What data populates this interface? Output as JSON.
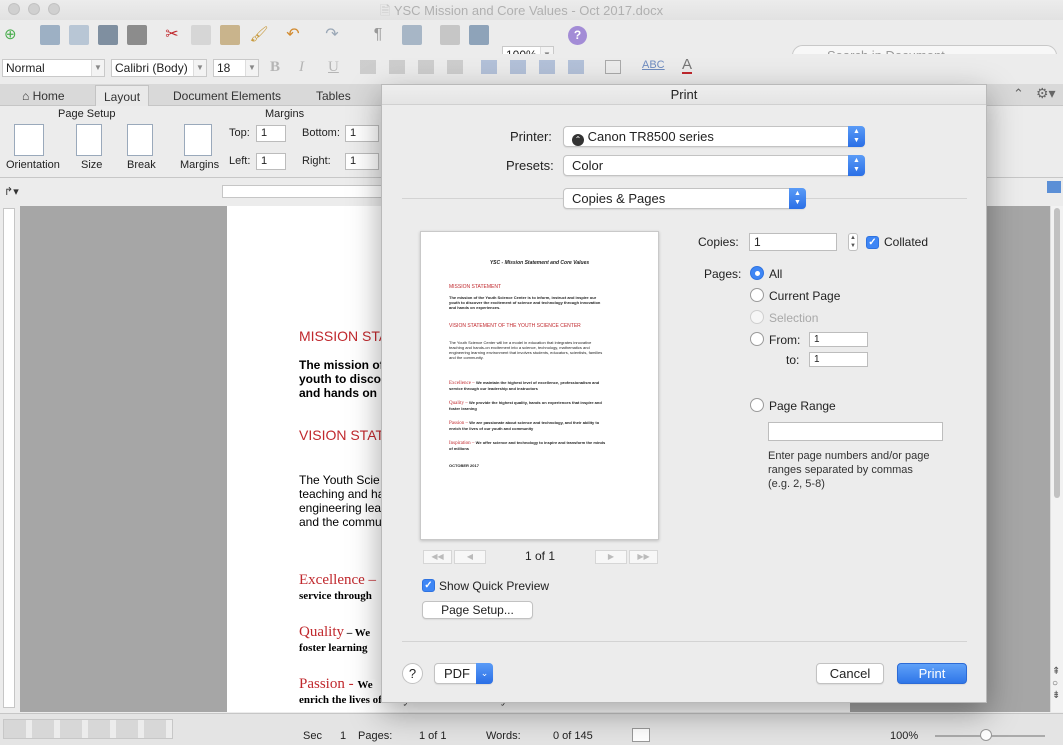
{
  "window": {
    "title": "YSC Mission and Core Values - Oct 2017.docx"
  },
  "toolbar": {
    "zoom": "100%",
    "search_placeholder": "Search in Document"
  },
  "format_bar": {
    "style": "Normal",
    "font": "Calibri (Body)",
    "size": "18"
  },
  "ribbon": {
    "tabs": [
      "Home",
      "Layout",
      "Document Elements",
      "Tables"
    ],
    "active_tab": "Layout",
    "page_setup_label": "Page Setup",
    "margins_label": "Margins",
    "buttons": {
      "orientation": "Orientation",
      "size": "Size",
      "break": "Break",
      "margins": "Margins"
    },
    "top_label": "Top:",
    "top_value": "1",
    "bottom_label": "Bottom:",
    "bottom_value": "1",
    "left_label": "Left:",
    "left_value": "1",
    "right_label": "Right:",
    "right_value": "1"
  },
  "document": {
    "mission_heading": "MISSION STA",
    "mission_line1": "The mission of",
    "mission_line2": "youth to disco",
    "mission_line3": "and hands on",
    "vision_heading": "VISION STAT",
    "vision_line1": "The Youth Scie",
    "vision_line2": "teaching and ha",
    "vision_line3": "engineering lea",
    "vision_line4": "and the commu",
    "excellence": "Excellence –",
    "excellence_sub": "service through",
    "quality": "Quality",
    "quality_dash": " – We",
    "quality_sub": "foster learning",
    "passion": "Passion - ",
    "passion_we": "We",
    "passion_sub": "enrich the lives of our youth and community"
  },
  "status": {
    "sec_label": "Sec",
    "sec_value": "1",
    "pages_label": "Pages:",
    "pages_value": "1 of 1",
    "words_label": "Words:",
    "words_value": "0 of 145",
    "zoom": "100%"
  },
  "print_dialog": {
    "title": "Print",
    "printer_label": "Printer:",
    "printer_value": "Canon TR8500 series",
    "presets_label": "Presets:",
    "presets_value": "Color",
    "section_value": "Copies & Pages",
    "copies_label": "Copies:",
    "copies_value": "1",
    "collated_label": "Collated",
    "collated_checked": true,
    "pages_label": "Pages:",
    "options": {
      "all": "All",
      "current": "Current Page",
      "selection": "Selection",
      "from": "From:",
      "to": "to:",
      "range": "Page Range"
    },
    "selected_option": "All",
    "from_value": "1",
    "to_value": "1",
    "range_help": [
      "Enter page numbers and/or page",
      "ranges separated by commas",
      "(e.g. 2, 5-8)"
    ],
    "page_indicator": "1 of 1",
    "show_quick_preview_label": "Show Quick Preview",
    "show_quick_preview_checked": true,
    "page_setup_button": "Page Setup...",
    "help_button": "?",
    "pdf_button": "PDF",
    "cancel_button": "Cancel",
    "print_button": "Print"
  },
  "preview": {
    "title": "YSC - Mission Statement and Core Values",
    "mission_heading": "MISSION STATEMENT",
    "mission_text": [
      "The mission of the Youth Science Center is to inform, instruct and inspire our",
      "youth to discover the excitement of science and technology through innovation",
      "and hands on experiences."
    ],
    "vision_heading": "VISION STATEMENT OF THE YOUTH SCIENCE CENTER",
    "vision_text": [
      "The Youth Science Center will be a model in education that integrates innovative",
      "teaching and hands-on excitement into a science, technology, mathematics and",
      "engineering learning environment that involves students, educators, scientists, families",
      "and the community."
    ],
    "excellence": [
      "Excellence – ",
      "We maintain the highest level of excellence, professionalism and",
      "service through our leadership and instructors"
    ],
    "quality": [
      "Quality – ",
      "We provide the highest quality, hands on experiences that inspire and",
      "foster learning"
    ],
    "passion": [
      "Passion – ",
      "We are passionate about science and technology, and their ability to",
      "enrich the lives of our youth and community"
    ],
    "inspiration": [
      "Inspiration – ",
      "We offer science and technology to inspire and transform the minds",
      "of millions"
    ],
    "date": "OCTOBER 2017"
  },
  "colors": {
    "accent": "#3e86f5",
    "doc_red": "#c0282d"
  }
}
